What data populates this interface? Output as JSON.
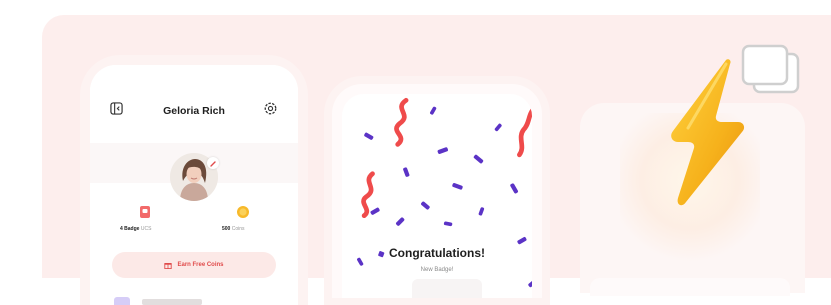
{
  "profile": {
    "name": "Geloria Rich",
    "badge_count": "4 Badge",
    "badge_unit": "UCS",
    "coin_count": "500",
    "coin_unit": "Coins",
    "earn_button_label": "Earn Free Coins"
  },
  "congrats": {
    "title": "Congratulations!",
    "subtitle": "New Badge!"
  },
  "colors": {
    "accent": "#e04a4a",
    "background": "#fdeeed",
    "bolt": "#f6b21c",
    "confetti_purple": "#5b33c6",
    "confetti_red": "#ef4b4b"
  },
  "icons": [
    "back-icon",
    "gear-icon",
    "edit-icon",
    "badge-icon",
    "coin-icon",
    "gift-icon",
    "lightning-bolt-icon",
    "windows-icon"
  ]
}
